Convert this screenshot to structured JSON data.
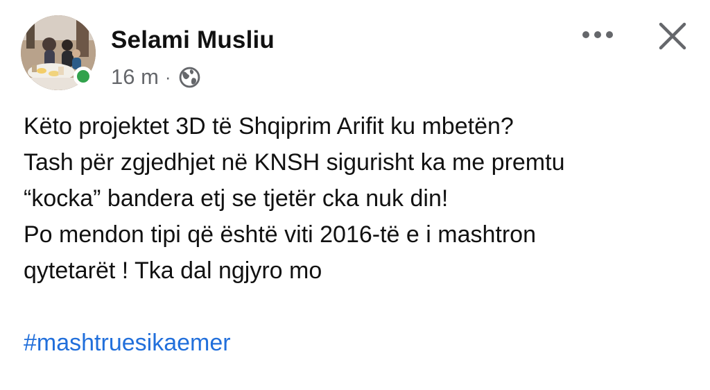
{
  "author": {
    "name": "Selami Musliu",
    "time": "16 m",
    "separator": "·",
    "visibility_icon": "globe-icon",
    "online_status": "online"
  },
  "actions": {
    "more_icon": "more-horizontal-icon",
    "close_icon": "close-icon"
  },
  "post": {
    "lines": [
      "Këto projektet 3D të Shqiprim Arifit ku mbetën?",
      "Tash për zgjedhjet në KNSH sigurisht ka me premtu",
      "“kocka” bandera etj se tjetër cka nuk din!",
      "Po mendon tipi që është viti 2016-të e i mashtron",
      "qytetarët ! Tka dal ngjyro mo"
    ],
    "hashtag": "#mashtruesikaemer"
  },
  "colors": {
    "text": "#111111",
    "secondary_text": "#65676b",
    "link": "#216fdb",
    "online": "#31a24c"
  }
}
